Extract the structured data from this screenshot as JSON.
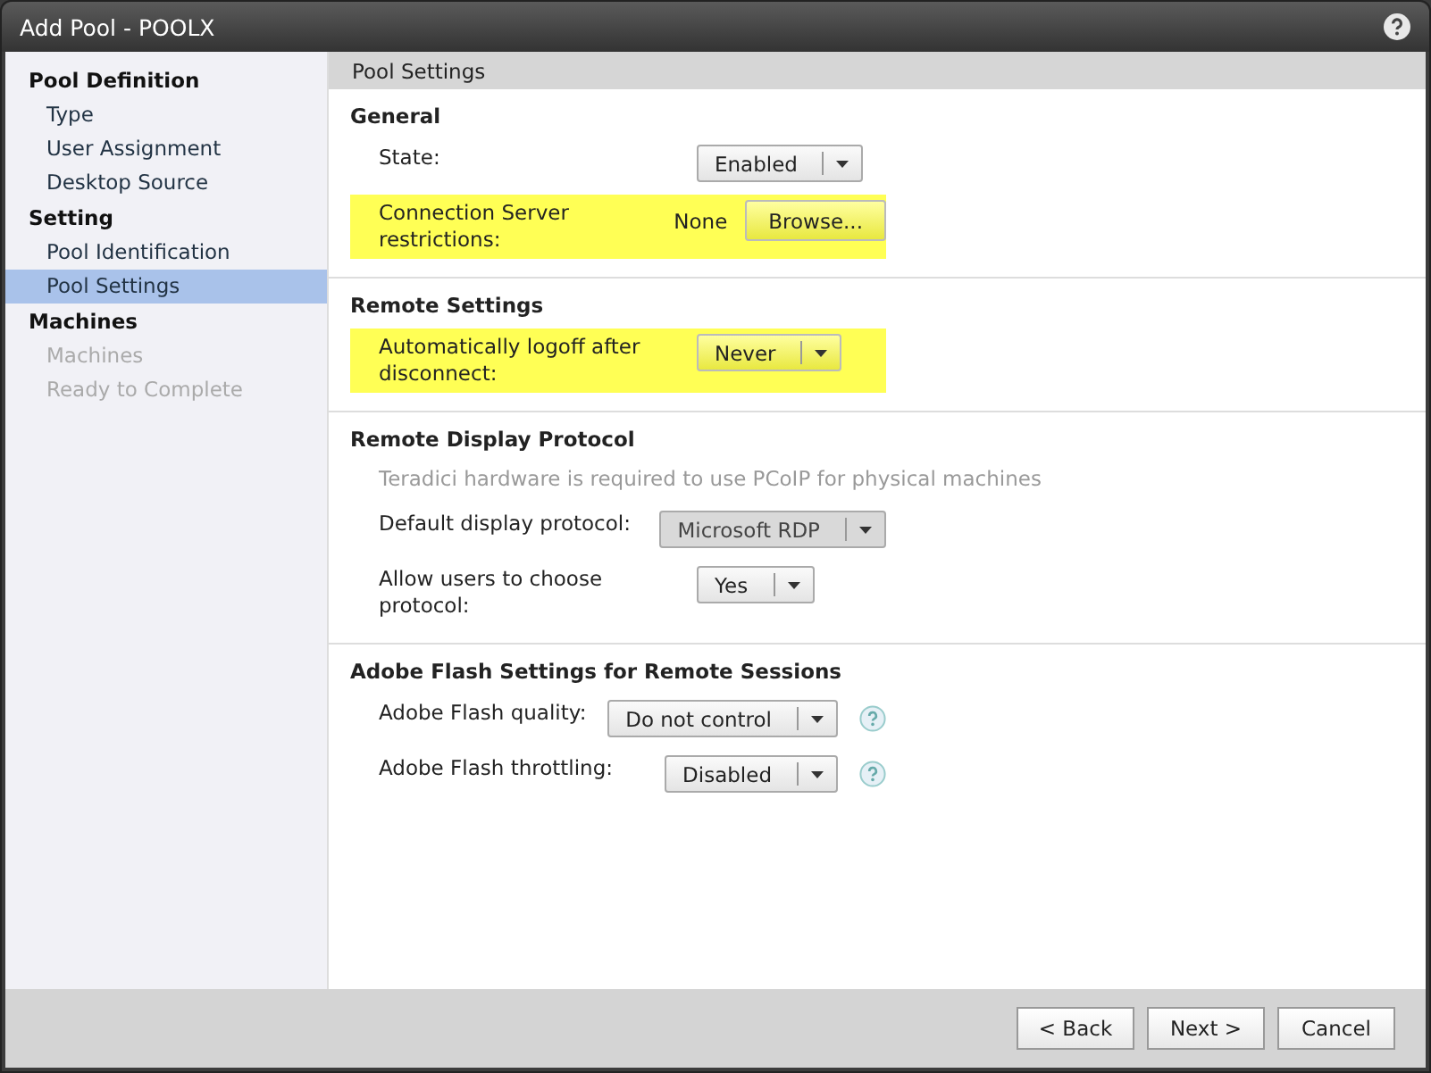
{
  "window": {
    "title": "Add Pool - POOLX"
  },
  "sidebar": {
    "groups": [
      {
        "heading": "Pool Definition",
        "items": [
          {
            "label": "Type",
            "selected": false,
            "disabled": false
          },
          {
            "label": "User Assignment",
            "selected": false,
            "disabled": false
          },
          {
            "label": "Desktop Source",
            "selected": false,
            "disabled": false
          }
        ]
      },
      {
        "heading": "Setting",
        "items": [
          {
            "label": "Pool Identification",
            "selected": false,
            "disabled": false
          },
          {
            "label": "Pool Settings",
            "selected": true,
            "disabled": false
          }
        ]
      },
      {
        "heading": "Machines",
        "items": [
          {
            "label": "Machines",
            "selected": false,
            "disabled": true
          },
          {
            "label": "Ready to Complete",
            "selected": false,
            "disabled": true
          }
        ]
      }
    ]
  },
  "content": {
    "header": "Pool Settings",
    "sections": [
      {
        "title": "General",
        "rows": [
          {
            "label": "State:",
            "kind": "dropdown",
            "value": "Enabled",
            "highlighted": false,
            "disabled": false,
            "help": false
          },
          {
            "label": "Connection Server restrictions:",
            "kind": "browse",
            "value": "None",
            "button": "Browse...",
            "highlighted": true,
            "disabled": false,
            "help": false
          }
        ]
      },
      {
        "title": "Remote Settings",
        "rows": [
          {
            "label": "Automatically logoff after disconnect:",
            "kind": "dropdown",
            "value": "Never",
            "highlighted": true,
            "disabled": false,
            "help": false
          }
        ]
      },
      {
        "title": "Remote Display Protocol",
        "note": "Teradici hardware is required to use PCoIP for physical machines",
        "rows": [
          {
            "label": "Default display protocol:",
            "kind": "dropdown",
            "value": "Microsoft RDP",
            "highlighted": false,
            "disabled": true,
            "help": false
          },
          {
            "label": "Allow users to choose protocol:",
            "kind": "dropdown",
            "value": "Yes",
            "highlighted": false,
            "disabled": false,
            "help": false
          }
        ]
      },
      {
        "title": "Adobe Flash Settings for Remote Sessions",
        "rows": [
          {
            "label": "Adobe Flash quality:",
            "kind": "dropdown",
            "value": "Do not control",
            "highlighted": false,
            "disabled": false,
            "help": true
          },
          {
            "label": "Adobe Flash throttling:",
            "kind": "dropdown",
            "value": "Disabled",
            "highlighted": false,
            "disabled": false,
            "help": true
          }
        ]
      }
    ]
  },
  "buttons": [
    "< Back",
    "Next >",
    "Cancel"
  ]
}
